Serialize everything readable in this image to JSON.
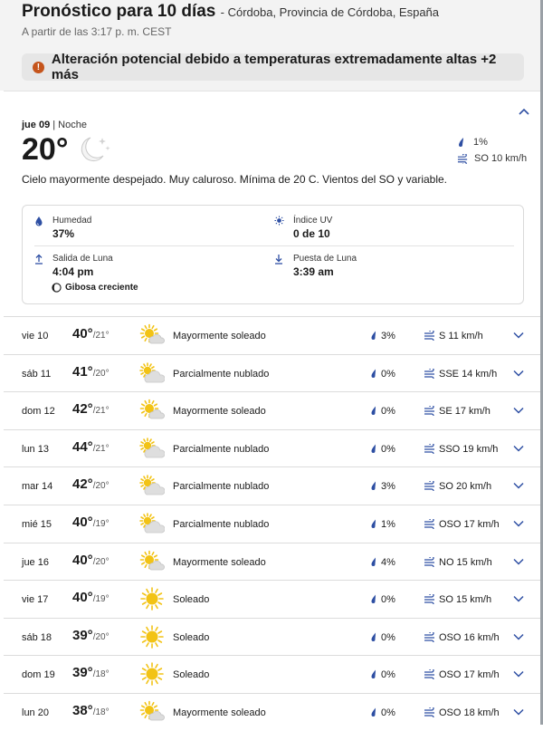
{
  "header": {
    "title": "Pronóstico para 10 días",
    "location": "- Córdoba, Provincia de Córdoba, España",
    "updated": "A partir de las 3:17 p. m. CEST"
  },
  "alert": {
    "icon": "alert-icon",
    "text": "Alteración potencial debido a temperaturas extremadamente altas +2 más"
  },
  "current": {
    "day": "jue 09",
    "separator": " | ",
    "period": "Noche",
    "temp": "20°",
    "icon": "moon-stars-icon",
    "precip": "1%",
    "wind": "SO 10 km/h",
    "description": "Cielo mayormente despejado. Muy caluroso. Mínima de 20 C. Vientos del SO y variable.",
    "details": {
      "humidity_label": "Humedad",
      "humidity_value": "37%",
      "uv_label": "Índice UV",
      "uv_value": "0 de 10",
      "moonrise_label": "Salida de Luna",
      "moonrise_value": "4:04 pm",
      "moonset_label": "Puesta de Luna",
      "moonset_value": "3:39 am",
      "phase": "Gibosa creciente"
    }
  },
  "forecast": [
    {
      "day": "vie 10",
      "hi": "40°",
      "lo": "/21°",
      "icon": "mostly-sunny-icon",
      "cond": "Mayormente soleado",
      "precip": "3%",
      "wind": "S 11 km/h"
    },
    {
      "day": "sáb 11",
      "hi": "41°",
      "lo": "/20°",
      "icon": "partly-cloudy-icon",
      "cond": "Parcialmente nublado",
      "precip": "0%",
      "wind": "SSE 14 km/h"
    },
    {
      "day": "dom 12",
      "hi": "42°",
      "lo": "/21°",
      "icon": "mostly-sunny-icon",
      "cond": "Mayormente soleado",
      "precip": "0%",
      "wind": "SE 17 km/h"
    },
    {
      "day": "lun 13",
      "hi": "44°",
      "lo": "/21°",
      "icon": "partly-cloudy-icon",
      "cond": "Parcialmente nublado",
      "precip": "0%",
      "wind": "SSO 19 km/h"
    },
    {
      "day": "mar 14",
      "hi": "42°",
      "lo": "/20°",
      "icon": "partly-cloudy-icon",
      "cond": "Parcialmente nublado",
      "precip": "3%",
      "wind": "SO 20 km/h"
    },
    {
      "day": "mié 15",
      "hi": "40°",
      "lo": "/19°",
      "icon": "partly-cloudy-icon",
      "cond": "Parcialmente nublado",
      "precip": "1%",
      "wind": "OSO 17 km/h"
    },
    {
      "day": "jue 16",
      "hi": "40°",
      "lo": "/20°",
      "icon": "mostly-sunny-icon",
      "cond": "Mayormente soleado",
      "precip": "4%",
      "wind": "NO 15 km/h"
    },
    {
      "day": "vie 17",
      "hi": "40°",
      "lo": "/19°",
      "icon": "sunny-icon",
      "cond": "Soleado",
      "precip": "0%",
      "wind": "SO 15 km/h"
    },
    {
      "day": "sáb 18",
      "hi": "39°",
      "lo": "/20°",
      "icon": "sunny-icon",
      "cond": "Soleado",
      "precip": "0%",
      "wind": "OSO 16 km/h"
    },
    {
      "day": "dom 19",
      "hi": "39°",
      "lo": "/18°",
      "icon": "sunny-icon",
      "cond": "Soleado",
      "precip": "0%",
      "wind": "OSO 17 km/h"
    },
    {
      "day": "lun 20",
      "hi": "38°",
      "lo": "/18°",
      "icon": "mostly-sunny-icon",
      "cond": "Mayormente soleado",
      "precip": "0%",
      "wind": "OSO 18 km/h"
    }
  ],
  "colors": {
    "accent": "#2e4fa3",
    "sun": "#f2c316",
    "alert": "#c5541b"
  }
}
